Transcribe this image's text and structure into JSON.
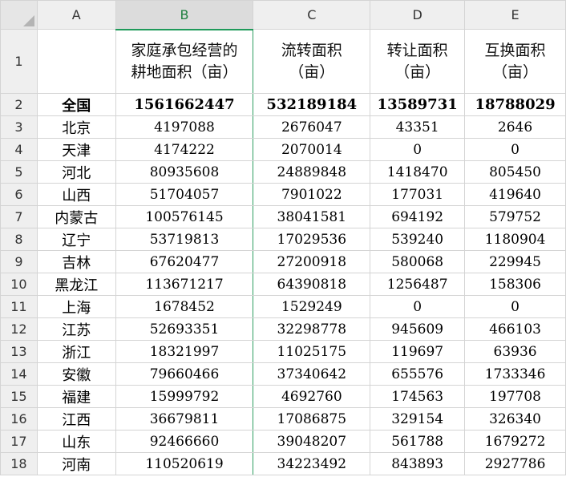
{
  "columns": [
    "A",
    "B",
    "C",
    "D",
    "E"
  ],
  "headers": {
    "a": "",
    "b": [
      "家庭承包经营的",
      "耕地面积（亩）"
    ],
    "c": [
      "流转面积",
      "（亩）"
    ],
    "d": [
      "转让面积",
      "（亩）"
    ],
    "e": [
      "互换面积",
      "（亩）"
    ]
  },
  "rows": [
    {
      "num": "1"
    },
    {
      "num": "2",
      "name": "全国",
      "b": "1561662447",
      "c": "532189184",
      "d": "13589731",
      "e": "18788029"
    },
    {
      "num": "3",
      "name": "北京",
      "b": "4197088",
      "c": "2676047",
      "d": "43351",
      "e": "2646"
    },
    {
      "num": "4",
      "name": "天津",
      "b": "4174222",
      "c": "2070014",
      "d": "0",
      "e": "0"
    },
    {
      "num": "5",
      "name": "河北",
      "b": "80935608",
      "c": "24889848",
      "d": "1418470",
      "e": "805450"
    },
    {
      "num": "6",
      "name": "山西",
      "b": "51704057",
      "c": "7901022",
      "d": "177031",
      "e": "419640"
    },
    {
      "num": "7",
      "name": "内蒙古",
      "b": "100576145",
      "c": "38041581",
      "d": "694192",
      "e": "579752"
    },
    {
      "num": "8",
      "name": "辽宁",
      "b": "53719813",
      "c": "17029536",
      "d": "539240",
      "e": "1180904"
    },
    {
      "num": "9",
      "name": "吉林",
      "b": "67620477",
      "c": "27200918",
      "d": "580068",
      "e": "229945"
    },
    {
      "num": "10",
      "name": "黑龙江",
      "b": "113671217",
      "c": "64390818",
      "d": "1256487",
      "e": "158306"
    },
    {
      "num": "11",
      "name": "上海",
      "b": "1678452",
      "c": "1529249",
      "d": "0",
      "e": "0"
    },
    {
      "num": "12",
      "name": "江苏",
      "b": "52693351",
      "c": "32298778",
      "d": "945609",
      "e": "466103"
    },
    {
      "num": "13",
      "name": "浙江",
      "b": "18321997",
      "c": "11025175",
      "d": "119697",
      "e": "63936"
    },
    {
      "num": "14",
      "name": "安徽",
      "b": "79660466",
      "c": "37340642",
      "d": "655576",
      "e": "1733346"
    },
    {
      "num": "15",
      "name": "福建",
      "b": "15999792",
      "c": "4692760",
      "d": "174563",
      "e": "197708"
    },
    {
      "num": "16",
      "name": "江西",
      "b": "36679811",
      "c": "17086875",
      "d": "329154",
      "e": "326340"
    },
    {
      "num": "17",
      "name": "山东",
      "b": "92466660",
      "c": "39048207",
      "d": "561788",
      "e": "1679272"
    },
    {
      "num": "18",
      "name": "河南",
      "b": "110520619",
      "c": "34223492",
      "d": "843893",
      "e": "2927786"
    }
  ],
  "colors": {
    "selected_column_accent": "#1f9a5a",
    "header_bg": "#efefef",
    "grid_line": "#d4d4d4"
  }
}
